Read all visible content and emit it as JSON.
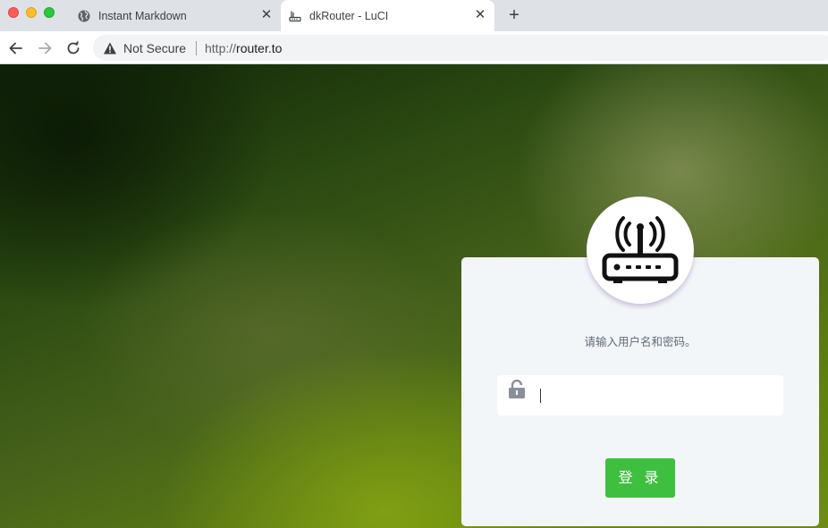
{
  "browser": {
    "tabs": [
      {
        "title": "Instant Markdown",
        "icon": "globe-icon",
        "active": false
      },
      {
        "title": "dkRouter - LuCI",
        "icon": "router-icon",
        "active": true
      }
    ],
    "new_tab_label": "+",
    "close_label": "✕",
    "security_label": "Not Secure",
    "url_scheme": "http://",
    "url_host": "router.to"
  },
  "login": {
    "logo_icon": "router-icon",
    "hint": "请输入用户名和密码。",
    "password_value": "",
    "lock_icon": "unlock-icon",
    "submit_label": "登 录",
    "accent_color": "#3fbf3f"
  }
}
